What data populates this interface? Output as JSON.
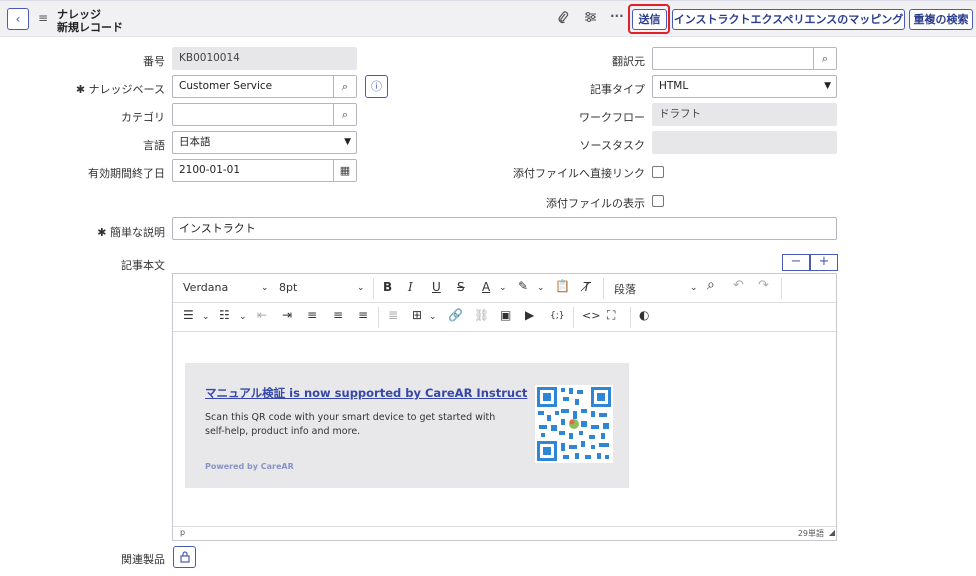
{
  "header": {
    "title_line1": "ナレッジ",
    "title_line2": "新規レコード",
    "submit_label": "送信",
    "mapping_label": "インストラクトエクスペリエンスのマッピング",
    "duplicate_label": "重複の検索",
    "more_label": "···"
  },
  "form": {
    "number_label": "番号",
    "number_value": "KB0010014",
    "kb_label": "ナレッジベース",
    "kb_value": "Customer Service",
    "category_label": "カテゴリ",
    "category_value": "",
    "language_label": "言語",
    "language_value": "日本語",
    "valid_to_label": "有効期間終了日",
    "valid_to_value": "2100-01-01",
    "translated_from_label": "翻訳元",
    "translated_from_value": "",
    "article_type_label": "記事タイプ",
    "article_type_value": "HTML",
    "workflow_label": "ワークフロー",
    "workflow_value": "ドラフト",
    "source_task_label": "ソースタスク",
    "source_task_value": "",
    "attachment_link_label": "添付ファイルへ直接リンク",
    "display_attachments_label": "添付ファイルの表示",
    "short_desc_label": "簡単な説明",
    "short_desc_value": "インストラクト",
    "article_body_label": "記事本文",
    "related_products_label": "関連製品",
    "required_mark": "✱"
  },
  "editor": {
    "font_family": "Verdana",
    "font_size": "8pt",
    "block_format": "段落",
    "status_path": "p",
    "word_count": "29単語",
    "banner": {
      "title": "マニュアル検証 is now supported by CareAR Instruct",
      "text": "Scan this QR code with your smart device to get started with self-help, product info and more.",
      "powered": "Powered by CareAR"
    }
  },
  "colors": {
    "accent": "#4a5bb5",
    "submit_highlight": "#e0202a",
    "banner_bg": "#e8e8ea",
    "qr_color": "#2f86d6"
  }
}
